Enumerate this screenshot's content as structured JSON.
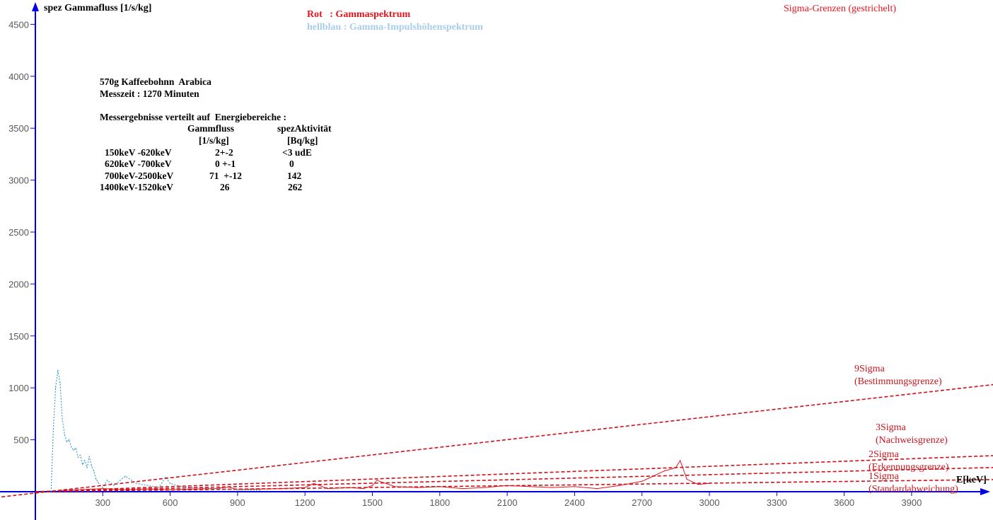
{
  "header": {
    "y_axis_label": "spez Gammafluss [1/s/kg]",
    "legend_red": "Rot   : Gammaspektrum",
    "legend_blue": "hellblau : Gamma-Impulshöhenspektrum",
    "sigma_title": "Sigma-Grenzen (gestrichelt)",
    "x_axis_unit": "E[keV]"
  },
  "info": {
    "line1": "570g Kaffeebohnn  Arabica",
    "line2": "Messzeit : 1270 Minuten",
    "line3": "Messergebnisse verteilt auf  Energiebereiche :",
    "col_flux": "Gammfluss",
    "col_activity": "spezAktivität",
    "unit_flux": "[1/s/kg]",
    "unit_activity": "[Bq/kg]",
    "rows": [
      {
        "range": "150keV -620keV",
        "flux": "2+-2",
        "activity": "<3 udE"
      },
      {
        "range": "620keV -700keV",
        "flux": "0 +-1",
        "activity": "0"
      },
      {
        "range": "700keV-2500keV",
        "flux": "71  +-12",
        "activity": "142"
      },
      {
        "range": "1400keV-1520keV",
        "flux": "26",
        "activity": "262"
      }
    ]
  },
  "sigma_labels": {
    "s9": "9Sigma",
    "s9_desc": "(Bestimmungsgrenze)",
    "s3": "3Sigma",
    "s3_desc": "(Nachweisgrenze)",
    "s2": "2Sigma",
    "s2_desc": "(Erkennungsgrenze)",
    "s1": "1Sigma",
    "s1_desc": "(Standardabweichung)"
  },
  "colors": {
    "axis": "#0000e0",
    "red": "#e8141b",
    "dashed_red": "#d0101a",
    "light_blue": "#2a9ad0"
  },
  "chart_data": {
    "type": "line",
    "title": "",
    "xlabel": "E[keV]",
    "ylabel": "spez Gammafluss [1/s/kg]",
    "xlim": [
      0,
      4300
    ],
    "ylim": [
      -300,
      4700
    ],
    "x_ticks": [
      300,
      600,
      900,
      1200,
      1500,
      1800,
      2100,
      2400,
      2700,
      3000,
      3300,
      3600,
      3900
    ],
    "y_ticks": [
      500,
      1000,
      1500,
      2000,
      2500,
      3000,
      3500,
      4000,
      4500
    ],
    "grid": false,
    "series": [
      {
        "name": "Gammaspektrum",
        "style": "solid",
        "color": "#e8141b",
        "x": [
          100,
          200,
          300,
          400,
          500,
          600,
          700,
          800,
          860,
          900,
          1000,
          1100,
          1200,
          1240,
          1300,
          1400,
          1460,
          1500,
          1520,
          1600,
          1700,
          1800,
          1900,
          2000,
          2100,
          2200,
          2300,
          2400,
          2500,
          2600,
          2650,
          2700,
          2750,
          2800,
          2850,
          2870,
          2900,
          2950,
          3000
        ],
        "values": [
          10,
          20,
          30,
          20,
          25,
          20,
          25,
          30,
          45,
          20,
          25,
          30,
          40,
          80,
          30,
          40,
          30,
          60,
          110,
          50,
          40,
          50,
          30,
          40,
          60,
          50,
          40,
          50,
          30,
          60,
          80,
          100,
          150,
          200,
          230,
          300,
          120,
          70,
          80
        ]
      },
      {
        "name": "Gamma-Impulshöhenspektrum",
        "style": "dotted",
        "color": "#2a9ad0",
        "x": [
          70,
          80,
          90,
          100,
          110,
          120,
          130,
          140,
          150,
          160,
          170,
          180,
          190,
          200,
          210,
          220,
          230,
          240,
          250,
          260,
          270,
          280,
          290,
          300,
          320,
          350,
          400,
          450,
          500,
          550,
          580,
          600,
          650,
          700,
          800,
          900,
          1000
        ],
        "values": [
          0,
          600,
          1000,
          1170,
          1050,
          700,
          550,
          480,
          500,
          430,
          400,
          420,
          330,
          350,
          260,
          300,
          230,
          340,
          250,
          200,
          120,
          90,
          60,
          40,
          110,
          60,
          150,
          80,
          60,
          40,
          140,
          80,
          50,
          40,
          30,
          20,
          15
        ]
      },
      {
        "name": "9Sigma",
        "style": "dashed",
        "color": "#d0101a",
        "x": [
          -150,
          4300
        ],
        "values": [
          -50,
          1040
        ]
      },
      {
        "name": "3Sigma",
        "style": "dashed",
        "color": "#d0101a",
        "x": [
          0,
          4300
        ],
        "values": [
          0,
          350
        ]
      },
      {
        "name": "2Sigma",
        "style": "dashed",
        "color": "#d0101a",
        "x": [
          0,
          4300
        ],
        "values": [
          0,
          235
        ]
      },
      {
        "name": "1Sigma",
        "style": "dashed",
        "color": "#d0101a",
        "x": [
          0,
          4300
        ],
        "values": [
          0,
          118
        ]
      }
    ]
  }
}
